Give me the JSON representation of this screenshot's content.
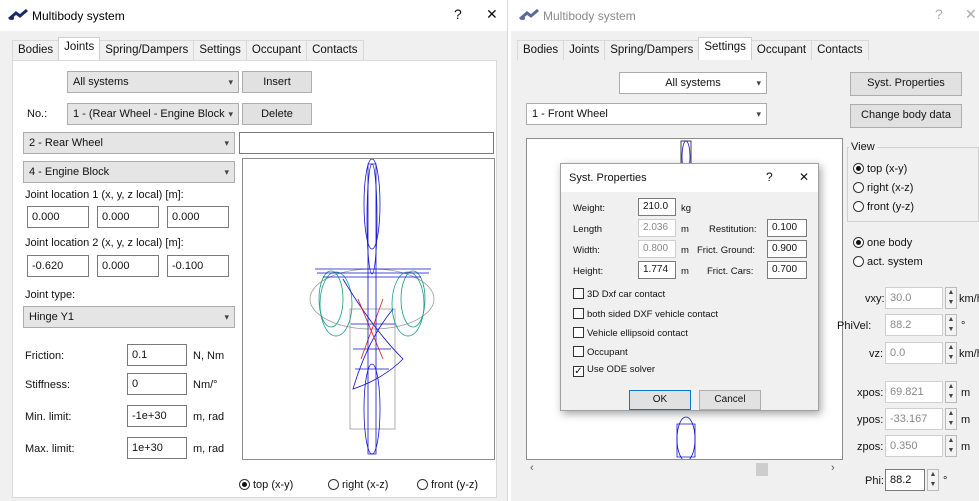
{
  "left_window": {
    "title": "Multibody system",
    "help": "?",
    "close": "✕",
    "tabs": [
      "Bodies",
      "Joints",
      "Spring/Dampers",
      "Settings",
      "Occupant",
      "Contacts"
    ],
    "active_tab": "Joints",
    "systems_combo": "All systems",
    "insert_label": "Insert",
    "no_label": "No.:",
    "joint_combo": "1 - (Rear Wheel - Engine Block",
    "delete_label": "Delete",
    "body1_combo": "2 - Rear Wheel",
    "body2_combo": "4 - Engine Block",
    "name_field": "",
    "loc1_label": "Joint location 1 (x, y, z local) [m]:",
    "loc1": [
      "0.000",
      "0.000",
      "0.000"
    ],
    "loc2_label": "Joint location 2 (x, y, z local) [m]:",
    "loc2": [
      "-0.620",
      "0.000",
      "-0.100"
    ],
    "joint_type_label": "Joint type:",
    "joint_type": "Hinge Y1",
    "params": [
      {
        "label": "Friction:",
        "value": "0.1",
        "unit": "N, Nm"
      },
      {
        "label": "Stiffness:",
        "value": "0",
        "unit": "Nm/°"
      },
      {
        "label": "Min. limit:",
        "value": "-1e+30",
        "unit": "m, rad"
      },
      {
        "label": "Max. limit:",
        "value": "1e+30",
        "unit": "m, rad"
      }
    ],
    "views": [
      "top (x-y)",
      "right (x-z)",
      "front (y-z)"
    ],
    "selected_view": "top (x-y)"
  },
  "right_window": {
    "title": "Multibody system",
    "help": "?",
    "close": "✕",
    "tabs": [
      "Bodies",
      "Joints",
      "Spring/Dampers",
      "Settings",
      "Occupant",
      "Contacts"
    ],
    "active_tab": "Settings",
    "systems_combo": "All systems",
    "body_combo": "1 - Front Wheel",
    "syst_props_label": "Syst. Properties",
    "change_body_label": "Change body data",
    "view_group": "View",
    "views": [
      "top (x-y)",
      "right (x-z)",
      "front (y-z)"
    ],
    "selected_view": "top (x-y)",
    "mode_options": [
      "one body",
      "act. system"
    ],
    "selected_mode": "one body",
    "readouts": [
      {
        "label": "vxy:",
        "value": "30.0",
        "unit": "km/h"
      },
      {
        "label": "PhiVel:",
        "value": "88.2",
        "unit": "°"
      },
      {
        "label": "vz:",
        "value": "0.0",
        "unit": "km/h"
      },
      {
        "label": "xpos:",
        "value": "69.821",
        "unit": "m"
      },
      {
        "label": "ypos:",
        "value": "-33.167",
        "unit": "m"
      },
      {
        "label": "zpos:",
        "value": "0.350",
        "unit": "m"
      }
    ],
    "phi_label": "Phi:",
    "phi_value": "88.2",
    "phi_unit": "°"
  },
  "dialog": {
    "title": "Syst. Properties",
    "help": "?",
    "close": "✕",
    "weight_label": "Weight:",
    "weight": "210.0",
    "weight_unit": "kg",
    "length_label": "Length",
    "length": "2.036",
    "length_unit": "m",
    "width_label": "Width:",
    "width": "0.800",
    "width_unit": "m",
    "height_label": "Height:",
    "height": "1.774",
    "height_unit": "m",
    "restitution_label": "Restitution:",
    "restitution": "0.100",
    "frict_ground_label": "Frict. Ground:",
    "frict_ground": "0.900",
    "frict_cars_label": "Frict. Cars:",
    "frict_cars": "0.700",
    "checks": [
      {
        "label": "3D Dxf car contact",
        "checked": false
      },
      {
        "label": "both sided DXF vehicle contact",
        "checked": false
      },
      {
        "label": "Vehicle ellipsoid contact",
        "checked": false
      },
      {
        "label": "Occupant",
        "checked": false
      },
      {
        "label": "Use ODE solver",
        "checked": true
      }
    ],
    "ok_label": "OK",
    "cancel_label": "Cancel"
  },
  "colors": {
    "wire_blue": "#1010d0",
    "wire_teal": "#1a9a8a",
    "wire_gray": "#9a9a9a",
    "wire_red": "#d02020"
  }
}
